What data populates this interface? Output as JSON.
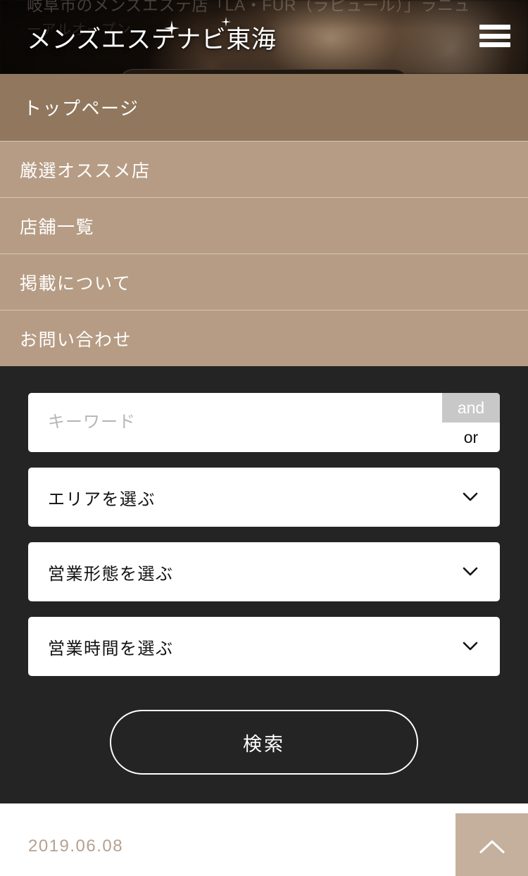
{
  "header": {
    "site_title": "メンズエステナビ東海",
    "ghost_line_1": "岐阜市のメンズエステ店「LA・FUR（ラピュール）」ラニュ",
    "ghost_line_2": "ーアルオープン",
    "menu_icon": "hamburger-icon"
  },
  "nav": {
    "items": [
      {
        "label": "トップページ"
      },
      {
        "label": "厳選オススメ店"
      },
      {
        "label": "店舗一覧"
      },
      {
        "label": "掲載について"
      },
      {
        "label": "お問い合わせ"
      }
    ]
  },
  "search": {
    "keyword": {
      "value": "",
      "placeholder": "キーワード"
    },
    "match_mode": {
      "options": [
        "and",
        "or"
      ],
      "selected": "and"
    },
    "selects": [
      {
        "label": "エリアを選ぶ",
        "icon": "chevron-down-icon"
      },
      {
        "label": "営業形態を選ぶ",
        "icon": "chevron-down-icon"
      },
      {
        "label": "営業時間を選ぶ",
        "icon": "chevron-down-icon"
      }
    ],
    "submit_label": "検索"
  },
  "footer": {
    "date": "2019.06.08",
    "to_top_icon": "chevron-up-icon"
  },
  "colors": {
    "nav_active": "#90775e",
    "nav_bg": "#b69c84",
    "search_bg": "#242424",
    "accent_tan": "#c4b09c",
    "date_text": "#b5a191",
    "toggle_selected_bg": "#c8c8c8"
  }
}
